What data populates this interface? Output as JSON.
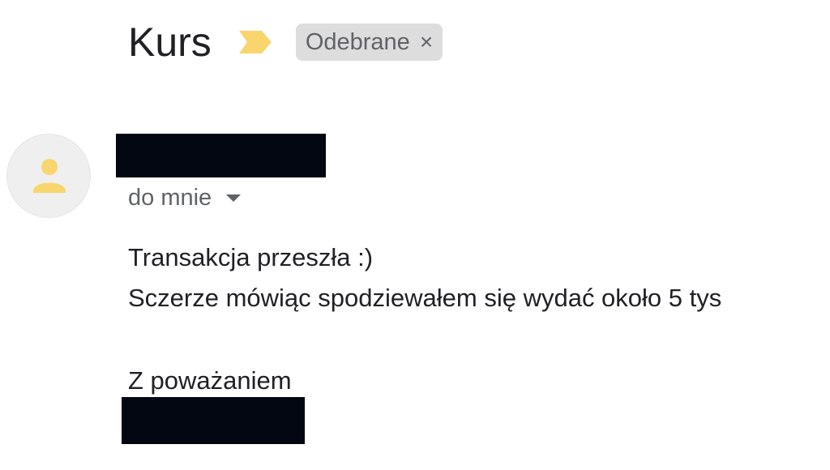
{
  "email": {
    "subject": "Kurs",
    "label_chip": {
      "text": "Odebrane",
      "close_glyph": "×"
    },
    "importance_icon": "importance-marker-icon",
    "importance_color": "#f9d56e",
    "sender": {
      "avatar_icon": "person-icon",
      "avatar_color": "#f9d56e",
      "recipient_text": "do mnie"
    },
    "body": {
      "line1": "Transakcja przeszła :)",
      "line2": "Sczerze mówiąc spodziewałem się wydać około 5 tys",
      "closing": "Z poważaniem"
    }
  }
}
